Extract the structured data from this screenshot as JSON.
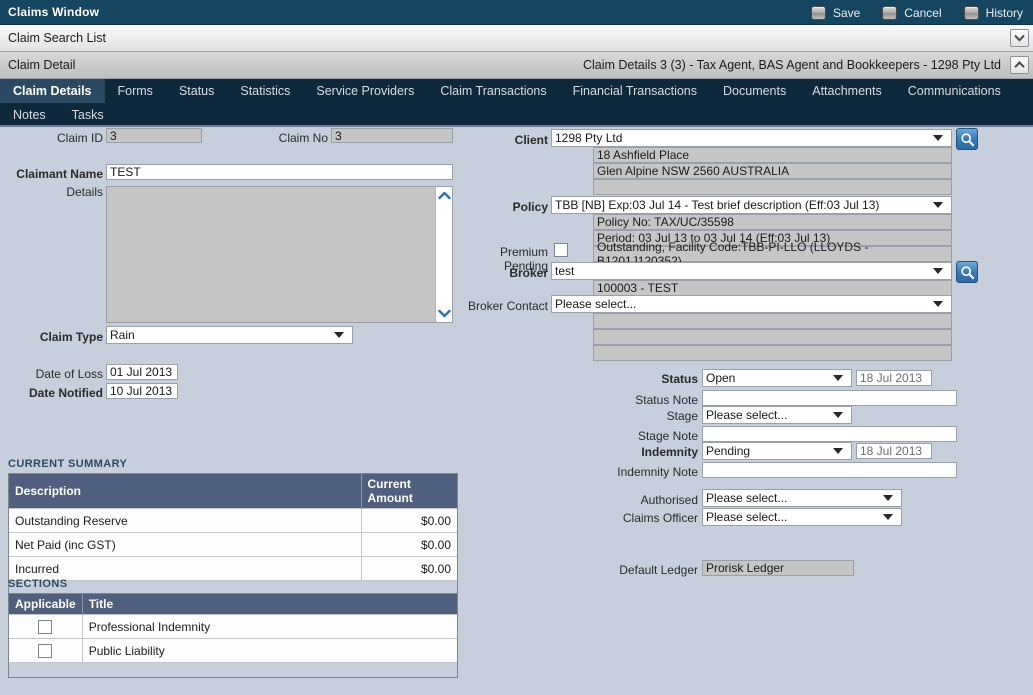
{
  "window": {
    "title": "Claims Window"
  },
  "toolbar": {
    "save_label": "Save",
    "cancel_label": "Cancel",
    "history_label": "History"
  },
  "breadcrumbs": {
    "search_list": "Claim Search List",
    "detail": "Claim Detail",
    "detail_summary": "Claim Details 3 (3) - Tax Agent, BAS Agent and Bookkeepers - 1298 Pty Ltd"
  },
  "tabs": {
    "row1": [
      {
        "label": "Claim Details",
        "active": true
      },
      {
        "label": "Forms",
        "active": false
      },
      {
        "label": "Status",
        "active": false
      },
      {
        "label": "Statistics",
        "active": false
      },
      {
        "label": "Service Providers",
        "active": false
      },
      {
        "label": "Claim Transactions",
        "active": false
      },
      {
        "label": "Financial Transactions",
        "active": false
      },
      {
        "label": "Documents",
        "active": false
      },
      {
        "label": "Attachments",
        "active": false
      },
      {
        "label": "Communications",
        "active": false
      }
    ],
    "row2": [
      {
        "label": "Notes",
        "active": false
      },
      {
        "label": "Tasks",
        "active": false
      }
    ]
  },
  "left_form": {
    "claim_id_label": "Claim ID",
    "claim_id_value": "3",
    "claim_no_label": "Claim No",
    "claim_no_value": "3",
    "claimant_name_label": "Claimant Name",
    "claimant_name_value": "TEST",
    "details_label": "Details",
    "details_value": "",
    "claim_type_label": "Claim Type",
    "claim_type_value": "Rain",
    "date_of_loss_label": "Date of Loss",
    "date_of_loss_value": "01 Jul 2013",
    "date_notified_label": "Date Notified",
    "date_notified_value": "10 Jul 2013"
  },
  "right_form": {
    "client_label": "Client",
    "client_value": "1298 Pty Ltd",
    "client_address_1": "18 Ashfield Place",
    "client_address_2": "Glen Alpine NSW 2560 AUSTRALIA",
    "client_address_3": "",
    "policy_label": "Policy",
    "policy_value": "TBB [NB] Exp:03 Jul 14 - Test brief description (Eff:03 Jul 13)",
    "policy_no_line": "Policy No: TAX/UC/35598",
    "policy_period_line": "Period: 03 Jul 13 to 03 Jul 14 (Eff:03 Jul 13)",
    "policy_facility_line": "Outstanding, Facility Code:TBB-PI-LLO (LLOYDS - B1201J120352)",
    "premium_pending_label": "Premium Pending",
    "premium_pending_checked": false,
    "broker_label": "Broker",
    "broker_value": "test",
    "broker_code_line": "100003 - TEST",
    "broker_contact_label": "Broker Contact",
    "broker_contact_value": "Please select...",
    "broker_contact_line_1": "",
    "broker_contact_line_2": "",
    "broker_contact_line_3": ""
  },
  "status_block": {
    "status_label": "Status",
    "status_value": "Open",
    "status_date": "18 Jul 2013",
    "status_note_label": "Status Note",
    "status_note_value": "",
    "stage_label": "Stage",
    "stage_value": "Please select...",
    "stage_note_label": "Stage Note",
    "stage_note_value": "",
    "indemnity_label": "Indemnity",
    "indemnity_value": "Pending",
    "indemnity_date": "18 Jul 2013",
    "indemnity_note_label": "Indemnity Note",
    "indemnity_note_value": "",
    "authorised_label": "Authorised",
    "authorised_value": "Please select...",
    "claims_officer_label": "Claims Officer",
    "claims_officer_value": "Please select...",
    "default_ledger_label": "Default Ledger",
    "default_ledger_value": "Prorisk Ledger"
  },
  "current_summary": {
    "title": "CURRENT SUMMARY",
    "columns": [
      "Description",
      "Current Amount"
    ],
    "rows": [
      {
        "description": "Outstanding Reserve",
        "amount": "$0.00"
      },
      {
        "description": "Net Paid (inc GST)",
        "amount": "$0.00"
      },
      {
        "description": "Incurred",
        "amount": "$0.00"
      }
    ]
  },
  "sections": {
    "title": "SECTIONS",
    "columns": [
      "Applicable",
      "Title"
    ],
    "rows": [
      {
        "applicable": false,
        "title": "Professional Indemnity"
      },
      {
        "applicable": false,
        "title": "Public Liability"
      }
    ]
  },
  "colors": {
    "titlebar": "#15455f",
    "tabbar": "#0e293c",
    "tab_active": "#2b4a62",
    "page_bg": "#c7cfdd",
    "grid_header": "#4f5f7d",
    "readonly_field": "#c6c6c6",
    "accent_blue": "#2e6aa3"
  },
  "icons": {
    "save": "save-icon",
    "cancel": "cancel-icon",
    "history": "history-icon",
    "client_search": "search-icon",
    "broker_search": "search-icon",
    "collapse": "chevron-up-icon",
    "expand": "chevron-down-icon"
  }
}
